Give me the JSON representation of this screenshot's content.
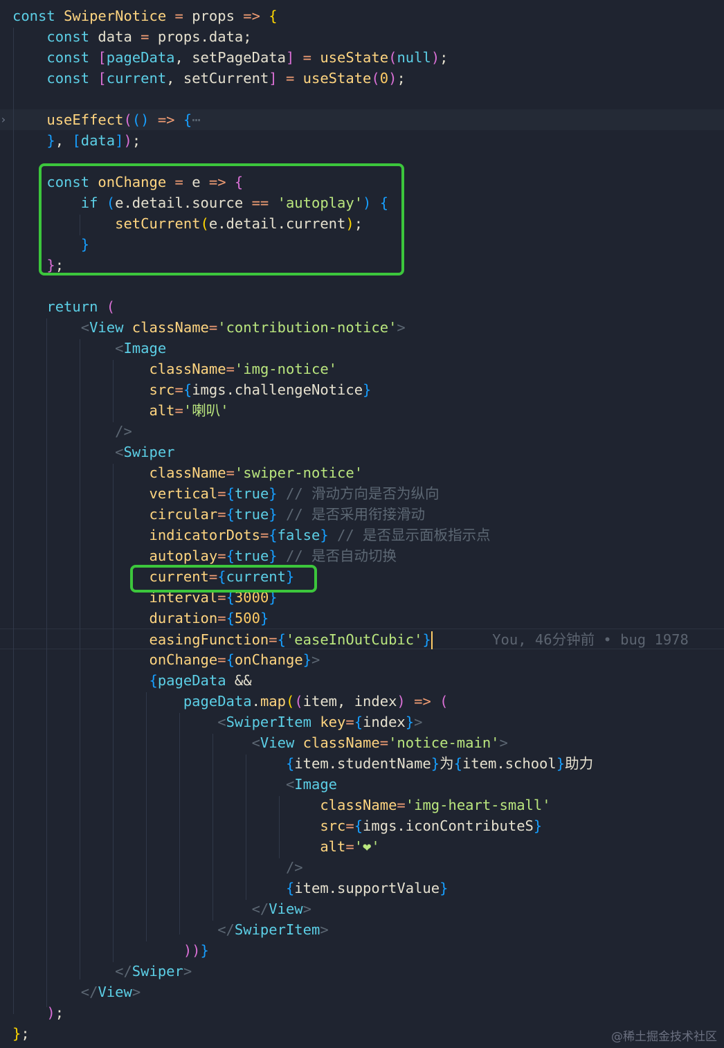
{
  "editor": {
    "blame": "You, 46分钟前 • bug 1978",
    "watermark": "@稀土掘金技术社区"
  },
  "lines": [
    [
      [
        "kw",
        "const "
      ],
      [
        "fn",
        "SwiperNotice"
      ],
      [
        "op",
        " = "
      ],
      [
        "plain",
        "props"
      ],
      [
        "op",
        " => "
      ],
      [
        "brk1",
        "{"
      ]
    ],
    [
      [
        "kw",
        "    const "
      ],
      [
        "plain",
        "data"
      ],
      [
        "op",
        " = "
      ],
      [
        "plain",
        "props.data;"
      ]
    ],
    [
      [
        "kw",
        "    const "
      ],
      [
        "brk2",
        "["
      ],
      [
        "kw",
        "pageData"
      ],
      [
        "plain",
        ", "
      ],
      [
        "plain",
        "setPageData"
      ],
      [
        "brk2",
        "]"
      ],
      [
        "op",
        " = "
      ],
      [
        "fn",
        "useState"
      ],
      [
        "brk2",
        "("
      ],
      [
        "kw",
        "null"
      ],
      [
        "brk2",
        ")"
      ],
      [
        "plain",
        ";"
      ]
    ],
    [
      [
        "kw",
        "    const "
      ],
      [
        "brk2",
        "["
      ],
      [
        "kw",
        "current"
      ],
      [
        "plain",
        ", "
      ],
      [
        "plain",
        "setCurrent"
      ],
      [
        "brk2",
        "]"
      ],
      [
        "op",
        " = "
      ],
      [
        "fn",
        "useState"
      ],
      [
        "brk2",
        "("
      ],
      [
        "num",
        "0"
      ],
      [
        "brk2",
        ")"
      ],
      [
        "plain",
        ";"
      ]
    ],
    [],
    [
      [
        "plain",
        "    "
      ],
      [
        "fn",
        "useEffect"
      ],
      [
        "brk2",
        "("
      ],
      [
        "brk3",
        "()"
      ],
      [
        "op",
        " => "
      ],
      [
        "brk3",
        "{"
      ],
      [
        "cmt",
        "⋯"
      ]
    ],
    [
      [
        "plain",
        "    "
      ],
      [
        "brk3",
        "}"
      ],
      [
        "plain",
        ", "
      ],
      [
        "brk3",
        "["
      ],
      [
        "kw",
        "data"
      ],
      [
        "brk3",
        "]"
      ],
      [
        "brk2",
        ")"
      ],
      [
        "plain",
        ";"
      ]
    ],
    [],
    [
      [
        "kw",
        "    const "
      ],
      [
        "fn",
        "onChange"
      ],
      [
        "op",
        " = "
      ],
      [
        "plain",
        "e"
      ],
      [
        "op",
        " => "
      ],
      [
        "brk2",
        "{"
      ]
    ],
    [
      [
        "kw",
        "        if "
      ],
      [
        "brk3",
        "("
      ],
      [
        "plain",
        "e.detail.source"
      ],
      [
        "op",
        " == "
      ],
      [
        "str",
        "'autoplay'"
      ],
      [
        "brk3",
        ")"
      ],
      [
        "plain",
        " "
      ],
      [
        "brk3",
        "{"
      ]
    ],
    [
      [
        "plain",
        "            "
      ],
      [
        "fn",
        "setCurrent"
      ],
      [
        "brk1",
        "("
      ],
      [
        "plain",
        "e.detail.current"
      ],
      [
        "brk1",
        ")"
      ],
      [
        "plain",
        ";"
      ]
    ],
    [
      [
        "plain",
        "        "
      ],
      [
        "brk3",
        "}"
      ]
    ],
    [
      [
        "plain",
        "    "
      ],
      [
        "brk2",
        "}"
      ],
      [
        "plain",
        ";"
      ]
    ],
    [],
    [
      [
        "kw",
        "    return "
      ],
      [
        "brk2",
        "("
      ]
    ],
    [
      [
        "plain",
        "        "
      ],
      [
        "tagp",
        "<"
      ],
      [
        "tag",
        "View"
      ],
      [
        "attr",
        " className"
      ],
      [
        "op",
        "="
      ],
      [
        "str",
        "'contribution-notice'"
      ],
      [
        "tagp",
        ">"
      ]
    ],
    [
      [
        "plain",
        "            "
      ],
      [
        "tagp",
        "<"
      ],
      [
        "tag",
        "Image"
      ]
    ],
    [
      [
        "plain",
        "                "
      ],
      [
        "attr",
        "className"
      ],
      [
        "op",
        "="
      ],
      [
        "str",
        "'img-notice'"
      ]
    ],
    [
      [
        "plain",
        "                "
      ],
      [
        "attr",
        "src"
      ],
      [
        "op",
        "="
      ],
      [
        "brk3",
        "{"
      ],
      [
        "plain",
        "imgs.challengeNotice"
      ],
      [
        "brk3",
        "}"
      ]
    ],
    [
      [
        "plain",
        "                "
      ],
      [
        "attr",
        "alt"
      ],
      [
        "op",
        "="
      ],
      [
        "str",
        "'喇叭'"
      ]
    ],
    [
      [
        "plain",
        "            "
      ],
      [
        "tagp",
        "/>"
      ]
    ],
    [
      [
        "plain",
        "            "
      ],
      [
        "tagp",
        "<"
      ],
      [
        "tag",
        "Swiper"
      ]
    ],
    [
      [
        "plain",
        "                "
      ],
      [
        "attr",
        "className"
      ],
      [
        "op",
        "="
      ],
      [
        "str",
        "'swiper-notice'"
      ]
    ],
    [
      [
        "plain",
        "                "
      ],
      [
        "attr",
        "vertical"
      ],
      [
        "op",
        "="
      ],
      [
        "brk3",
        "{"
      ],
      [
        "kw",
        "true"
      ],
      [
        "brk3",
        "}"
      ],
      [
        "cmt",
        " // 滑动方向是否为纵向"
      ]
    ],
    [
      [
        "plain",
        "                "
      ],
      [
        "attr",
        "circular"
      ],
      [
        "op",
        "="
      ],
      [
        "brk3",
        "{"
      ],
      [
        "kw",
        "true"
      ],
      [
        "brk3",
        "}"
      ],
      [
        "cmt",
        " // 是否采用衔接滑动"
      ]
    ],
    [
      [
        "plain",
        "                "
      ],
      [
        "attr",
        "indicatorDots"
      ],
      [
        "op",
        "="
      ],
      [
        "brk3",
        "{"
      ],
      [
        "kw",
        "false"
      ],
      [
        "brk3",
        "}"
      ],
      [
        "cmt",
        " // 是否显示面板指示点"
      ]
    ],
    [
      [
        "plain",
        "                "
      ],
      [
        "attr",
        "autoplay"
      ],
      [
        "op",
        "="
      ],
      [
        "brk3",
        "{"
      ],
      [
        "kw",
        "true"
      ],
      [
        "brk3",
        "}"
      ],
      [
        "cmt",
        " // 是否自动切换"
      ]
    ],
    [
      [
        "plain",
        "                "
      ],
      [
        "attr",
        "current"
      ],
      [
        "op",
        "="
      ],
      [
        "brk3",
        "{"
      ],
      [
        "kw",
        "current"
      ],
      [
        "brk3",
        "}"
      ]
    ],
    [
      [
        "plain",
        "                "
      ],
      [
        "attr",
        "interval"
      ],
      [
        "op",
        "="
      ],
      [
        "brk3",
        "{"
      ],
      [
        "num",
        "3000"
      ],
      [
        "brk3",
        "}"
      ]
    ],
    [
      [
        "plain",
        "                "
      ],
      [
        "attr",
        "duration"
      ],
      [
        "op",
        "="
      ],
      [
        "brk3",
        "{"
      ],
      [
        "num",
        "500"
      ],
      [
        "brk3",
        "}"
      ]
    ],
    [
      [
        "plain",
        "                "
      ],
      [
        "attr",
        "easingFunction"
      ],
      [
        "op",
        "="
      ],
      [
        "brk3",
        "{"
      ],
      [
        "str",
        "'easeInOutCubic'"
      ],
      [
        "brk3",
        "}"
      ],
      [
        "cursor",
        ""
      ]
    ],
    [
      [
        "plain",
        "                "
      ],
      [
        "attr",
        "onChange"
      ],
      [
        "op",
        "="
      ],
      [
        "brk3",
        "{"
      ],
      [
        "fn",
        "onChange"
      ],
      [
        "brk3",
        "}"
      ],
      [
        "tagp",
        ">"
      ]
    ],
    [
      [
        "plain",
        "                "
      ],
      [
        "brk3",
        "{"
      ],
      [
        "kw",
        "pageData"
      ],
      [
        "plain",
        " &&"
      ]
    ],
    [
      [
        "plain",
        "                    "
      ],
      [
        "kw",
        "pageData"
      ],
      [
        "plain",
        "."
      ],
      [
        "fn",
        "map"
      ],
      [
        "brk1",
        "("
      ],
      [
        "brk2",
        "("
      ],
      [
        "plain",
        "item, index"
      ],
      [
        "brk2",
        ")"
      ],
      [
        "op",
        " => "
      ],
      [
        "brk2",
        "("
      ]
    ],
    [
      [
        "plain",
        "                        "
      ],
      [
        "tagp",
        "<"
      ],
      [
        "tag",
        "SwiperItem"
      ],
      [
        "attr",
        " key"
      ],
      [
        "op",
        "="
      ],
      [
        "brk3",
        "{"
      ],
      [
        "plain",
        "index"
      ],
      [
        "brk3",
        "}"
      ],
      [
        "tagp",
        ">"
      ]
    ],
    [
      [
        "plain",
        "                            "
      ],
      [
        "tagp",
        "<"
      ],
      [
        "tag",
        "View"
      ],
      [
        "attr",
        " className"
      ],
      [
        "op",
        "="
      ],
      [
        "str",
        "'notice-main'"
      ],
      [
        "tagp",
        ">"
      ]
    ],
    [
      [
        "plain",
        "                                "
      ],
      [
        "brk3",
        "{"
      ],
      [
        "plain",
        "item.studentName"
      ],
      [
        "brk3",
        "}"
      ],
      [
        "plain",
        "为"
      ],
      [
        "brk3",
        "{"
      ],
      [
        "plain",
        "item.school"
      ],
      [
        "brk3",
        "}"
      ],
      [
        "plain",
        "助力"
      ]
    ],
    [
      [
        "plain",
        "                                "
      ],
      [
        "tagp",
        "<"
      ],
      [
        "tag",
        "Image"
      ]
    ],
    [
      [
        "plain",
        "                                    "
      ],
      [
        "attr",
        "className"
      ],
      [
        "op",
        "="
      ],
      [
        "str",
        "'img-heart-small'"
      ]
    ],
    [
      [
        "plain",
        "                                    "
      ],
      [
        "attr",
        "src"
      ],
      [
        "op",
        "="
      ],
      [
        "brk3",
        "{"
      ],
      [
        "plain",
        "imgs.iconContributeS"
      ],
      [
        "brk3",
        "}"
      ]
    ],
    [
      [
        "plain",
        "                                    "
      ],
      [
        "attr",
        "alt"
      ],
      [
        "op",
        "="
      ],
      [
        "str",
        "'❤'"
      ]
    ],
    [
      [
        "plain",
        "                                "
      ],
      [
        "tagp",
        "/>"
      ]
    ],
    [
      [
        "plain",
        "                                "
      ],
      [
        "brk3",
        "{"
      ],
      [
        "plain",
        "item.supportValue"
      ],
      [
        "brk3",
        "}"
      ]
    ],
    [
      [
        "plain",
        "                            "
      ],
      [
        "tagp",
        "</"
      ],
      [
        "tag",
        "View"
      ],
      [
        "tagp",
        ">"
      ]
    ],
    [
      [
        "plain",
        "                        "
      ],
      [
        "tagp",
        "</"
      ],
      [
        "tag",
        "SwiperItem"
      ],
      [
        "tagp",
        ">"
      ]
    ],
    [
      [
        "plain",
        "                    "
      ],
      [
        "brk2",
        "))"
      ],
      [
        "brk3",
        "}"
      ]
    ],
    [
      [
        "plain",
        "            "
      ],
      [
        "tagp",
        "</"
      ],
      [
        "tag",
        "Swiper"
      ],
      [
        "tagp",
        ">"
      ]
    ],
    [
      [
        "plain",
        "        "
      ],
      [
        "tagp",
        "</"
      ],
      [
        "tag",
        "View"
      ],
      [
        "tagp",
        ">"
      ]
    ],
    [
      [
        "plain",
        "    "
      ],
      [
        "brk2",
        ")"
      ],
      [
        "plain",
        ";"
      ]
    ],
    [
      [
        "brk1",
        "}"
      ],
      [
        "plain",
        ";"
      ]
    ]
  ]
}
